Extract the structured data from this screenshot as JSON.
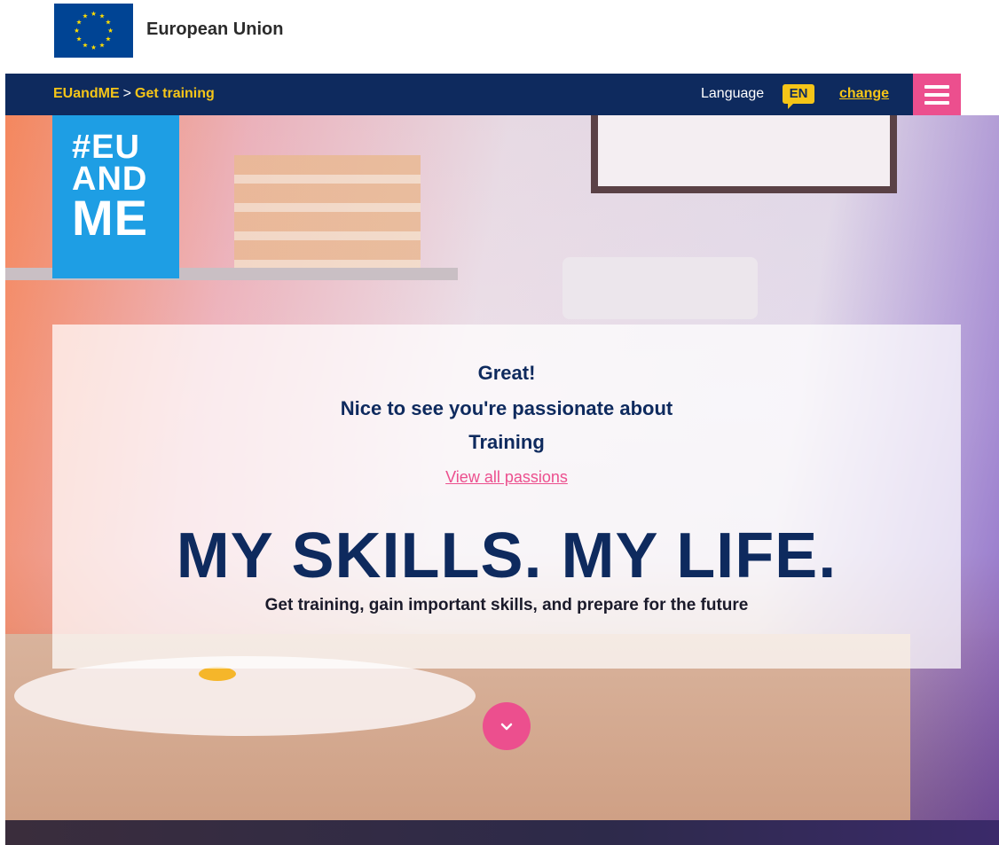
{
  "eu_header": {
    "name": "European Union",
    "flag_icon": "eu-flag-icon"
  },
  "navbar": {
    "breadcrumb": {
      "home": "EUandME",
      "separator": ">",
      "current": "Get training"
    },
    "language_label": "Language",
    "language_code": "EN",
    "language_change": "change",
    "menu_icon": "hamburger-menu-icon"
  },
  "logo": {
    "line1": "#EU",
    "line2": "AND",
    "line3": "ME"
  },
  "hero": {
    "intro_line1": "Great!",
    "intro_line2": "Nice to see you're passionate about",
    "intro_line3": "Training",
    "passions_link": "View all passions",
    "headline": "MY SKILLS. MY LIFE.",
    "subline": "Get training, gain important skills, and prepare for the future",
    "scroll_icon": "chevron-down-icon"
  },
  "colors": {
    "navy": "#0e2a5e",
    "yellow": "#f5c518",
    "pink": "#ec4f8e",
    "logo_blue": "#1e9ee4",
    "eu_blue": "#004494"
  }
}
